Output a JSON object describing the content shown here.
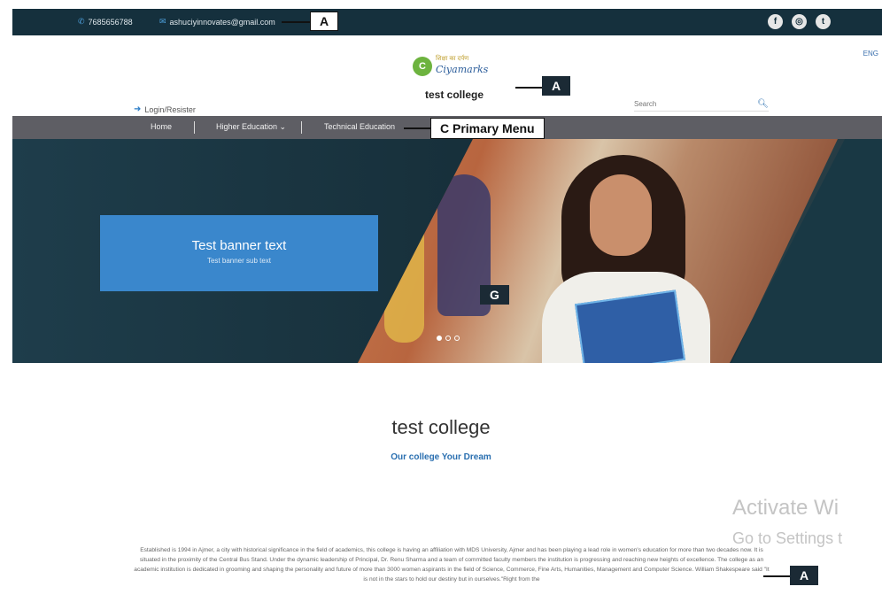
{
  "topbar": {
    "phone": "7685656788",
    "email": "ashuciyinnovates@gmail.com",
    "social": [
      {
        "icon": "facebook-icon",
        "glyph": "f"
      },
      {
        "icon": "instagram-icon",
        "glyph": "◎"
      },
      {
        "icon": "twitter-icon",
        "glyph": "t"
      }
    ]
  },
  "header": {
    "language": "ENG",
    "logo_script": "शिक्षा का दर्पण",
    "logo_brand": "Ciyamarks",
    "site_name": "test college",
    "login": "Login/Resister",
    "search_placeholder": "Search"
  },
  "menu": {
    "items": [
      "Home",
      "Higher Education ⌄",
      "Technical Education"
    ]
  },
  "hero": {
    "title": "Test banner text",
    "subtitle": "Test banner sub text",
    "active_slide": 1,
    "slide_count": 3
  },
  "main": {
    "title": "test college",
    "tagline": "Our college Your Dream",
    "about": "Established is 1994 in Ajmer, a city with historical significance in the field of academics, this college is having an affiliation with MDS University, Ajmer and has been playing a lead role in women's education for more than two decades now. It is situated in the proximity of the Central Bus Stand. Under the dynamic leadership of Principal, Dr. Renu Sharma and a team of committed faculty members the institution is progressing and reaching new heights of excellence. The college as an academic institution is dedicated in grooming and shaping the personality and future of more than 3000 women aspirants in the field of Science, Commerce, Fine Arts, Humanities, Management and Computer Science. William Shakespeare said \"It is not in the stars to hold our destiny but in ourselves.\"Right from the"
  },
  "annotations": {
    "top_email": "A",
    "logo": "A",
    "menu": "C   Primary Menu",
    "banner": "G",
    "about": "A"
  },
  "watermark": {
    "line1": "Activate Wi",
    "line2": "Go to Settings t"
  },
  "colors": {
    "topbar": "#15303d",
    "menubar": "#5e5e64",
    "banner_box": "#3a87cc",
    "accent_link": "#2a6fb0"
  }
}
